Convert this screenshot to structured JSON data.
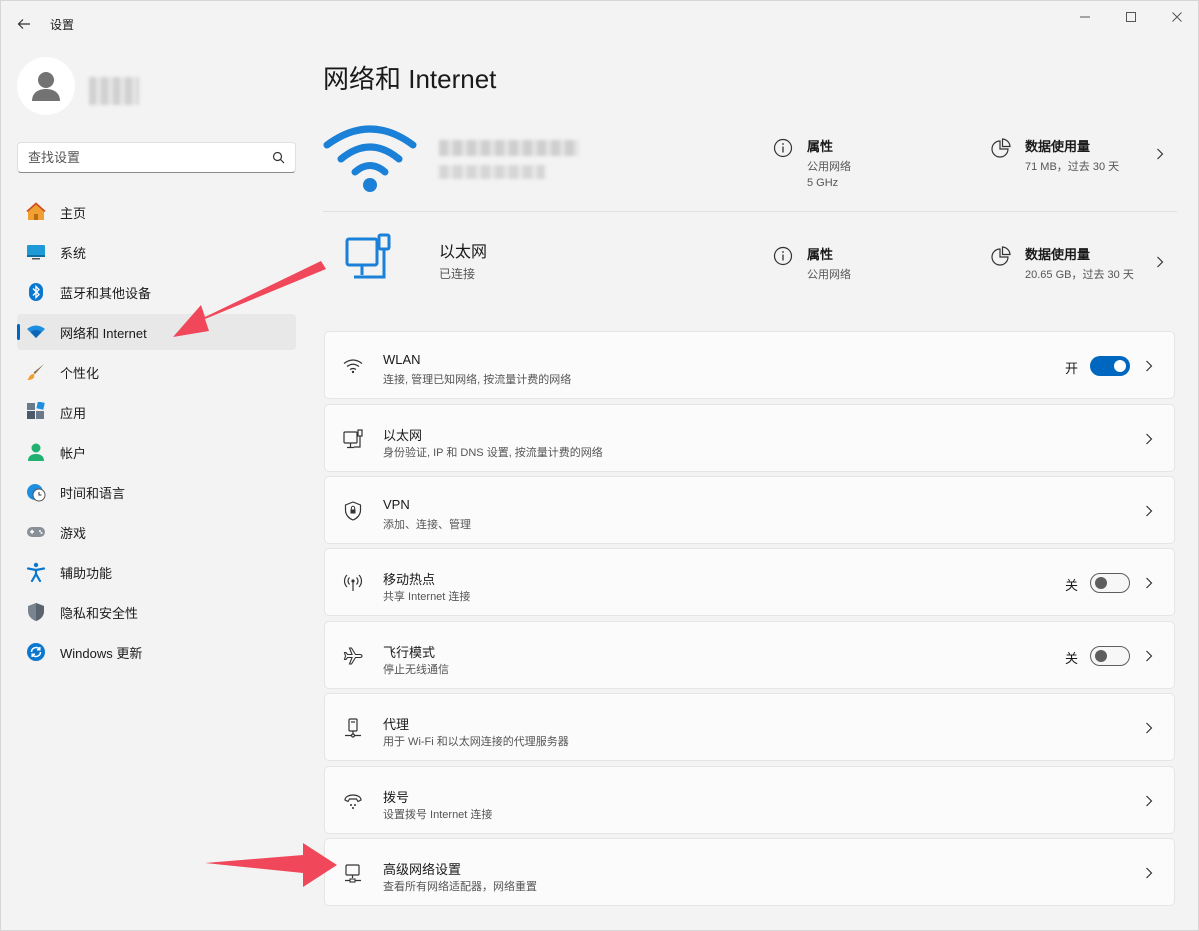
{
  "window": {
    "title": "设置",
    "controls": [
      "minimize-icon",
      "maximize-icon",
      "close-icon"
    ]
  },
  "profile": {
    "avatar_icon": "user-icon"
  },
  "search": {
    "placeholder": "查找设置",
    "icon": "search-icon"
  },
  "sidebar": {
    "items": [
      {
        "label": "主页",
        "icon": "home-icon",
        "active": false
      },
      {
        "label": "系统",
        "icon": "system-icon",
        "active": false
      },
      {
        "label": "蓝牙和其他设备",
        "icon": "bluetooth-icon",
        "active": false
      },
      {
        "label": "网络和 Internet",
        "icon": "wifi-icon",
        "active": true
      },
      {
        "label": "个性化",
        "icon": "brush-icon",
        "active": false
      },
      {
        "label": "应用",
        "icon": "apps-icon",
        "active": false
      },
      {
        "label": "帐户",
        "icon": "account-icon",
        "active": false
      },
      {
        "label": "时间和语言",
        "icon": "clock-globe-icon",
        "active": false
      },
      {
        "label": "游戏",
        "icon": "gamepad-icon",
        "active": false
      },
      {
        "label": "辅助功能",
        "icon": "accessibility-icon",
        "active": false
      },
      {
        "label": "隐私和安全性",
        "icon": "shield-icon",
        "active": false
      },
      {
        "label": "Windows 更新",
        "icon": "update-icon",
        "active": false
      }
    ]
  },
  "main": {
    "title": "网络和 Internet",
    "wifi_status": {
      "properties": {
        "title": "属性",
        "line1": "公用网络",
        "line2": "5 GHz"
      },
      "data_usage": {
        "title": "数据使用量",
        "sub": "71 MB，过去 30 天"
      }
    },
    "ethernet_status": {
      "name": "以太网",
      "status": "已连接",
      "properties": {
        "title": "属性",
        "line1": "公用网络"
      },
      "data_usage": {
        "title": "数据使用量",
        "sub": "20.65 GB，过去 30 天"
      }
    },
    "cards": [
      {
        "title": "WLAN",
        "sub": "连接, 管理已知网络, 按流量计费的网络",
        "icon": "wifi-icon",
        "toggle": "on",
        "state": "开"
      },
      {
        "title": "以太网",
        "sub": "身份验证, IP 和 DNS 设置, 按流量计费的网络",
        "icon": "ethernet-icon"
      },
      {
        "title": "VPN",
        "sub": "添加、连接、管理",
        "icon": "vpn-shield-icon"
      },
      {
        "title": "移动热点",
        "sub": "共享 Internet 连接",
        "icon": "hotspot-icon",
        "toggle": "off",
        "state": "关"
      },
      {
        "title": "飞行模式",
        "sub": "停止无线通信",
        "icon": "airplane-icon",
        "toggle": "off",
        "state": "关"
      },
      {
        "title": "代理",
        "sub": "用于 Wi-Fi 和以太网连接的代理服务器",
        "icon": "proxy-icon"
      },
      {
        "title": "拨号",
        "sub": "设置拨号 Internet 连接",
        "icon": "dialup-icon"
      },
      {
        "title": "高级网络设置",
        "sub": "查看所有网络适配器，网络重置",
        "icon": "advanced-network-icon"
      }
    ]
  },
  "colors": {
    "accent": "#0067c0",
    "annotation_arrow": "#f0485a",
    "background": "#f3f3f3",
    "card": "#fbfbfb"
  }
}
